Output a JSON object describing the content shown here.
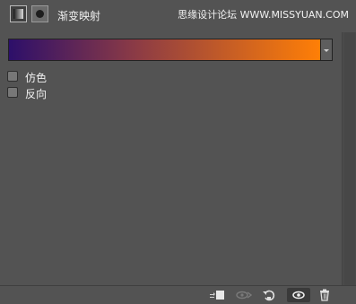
{
  "header": {
    "title": "渐变映射",
    "watermark": "思缘设计论坛 WWW.MISSYUAN.COM"
  },
  "gradient": {
    "colors": [
      "#2d0f6a",
      "#8a3a46",
      "#ff7f06"
    ]
  },
  "options": [
    {
      "label": "仿色",
      "checked": false
    },
    {
      "label": "反向",
      "checked": false
    }
  ],
  "footer": {
    "icons": [
      "clip-to-layer-icon",
      "view-previous-state-icon",
      "reset-icon",
      "visibility-eye-icon",
      "trash-icon"
    ]
  }
}
